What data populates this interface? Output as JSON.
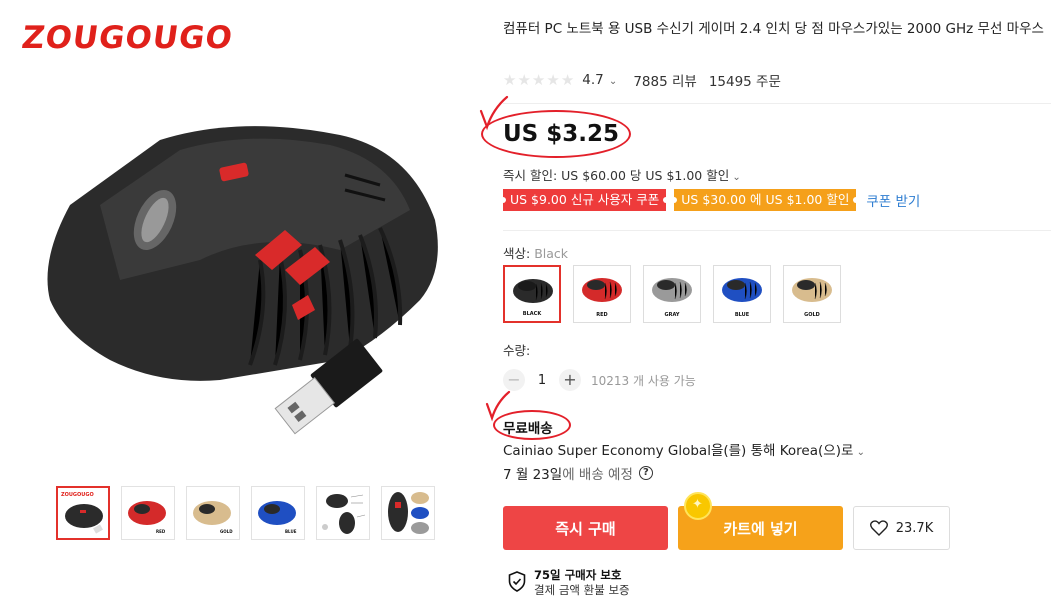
{
  "brand": {
    "logo_text": "ZOUGOUGO"
  },
  "product": {
    "title": "컴퓨터 PC 노트북 용 USB 수신기 게이머 2.4 인치 당 점 마우스가있는 2000 GHz 무선 마우스",
    "rating": "4.7",
    "reviews": "7885 리뷰",
    "orders": "15495 주문"
  },
  "price": {
    "current": "US $3.25",
    "instant_discount": "즉시 할인: US $60.00 당 US $1.00 할인",
    "coupons": [
      {
        "label": "US $9.00 신규 사용자 쿠폰",
        "color": "#ee3b3b"
      },
      {
        "label": "US $30.00 에 US $1.00 할인",
        "color": "#f5a01a"
      }
    ],
    "get_coupon": "쿠폰 받기"
  },
  "color": {
    "label": "색상:",
    "selected_name": "Black",
    "options": [
      {
        "name": "BLACK",
        "body": "#2a2a2a",
        "accent": "#1a1a1a"
      },
      {
        "name": "RED",
        "body": "#d42a2a",
        "accent": "#2a2a2a"
      },
      {
        "name": "GRAY",
        "body": "#9a9a9a",
        "accent": "#2a2a2a"
      },
      {
        "name": "BLUE",
        "body": "#1f4fc2",
        "accent": "#2a2a2a"
      },
      {
        "name": "GOLD",
        "body": "#d8bc8e",
        "accent": "#2a2a2a"
      }
    ]
  },
  "quantity": {
    "label": "수량:",
    "value": "1",
    "minus": "−",
    "plus": "+",
    "available": "10213 개 사용 가능"
  },
  "shipping": {
    "title": "무료배송",
    "method": "Cainiao Super Economy Global을(를) 통해 Korea(으)로",
    "delivery_date": "7 월 23일",
    "delivery_suffix": "에 배송 예정",
    "help": "?"
  },
  "actions": {
    "buy_now": "즉시 구매",
    "add_to_cart": "카트에 넣기",
    "wishlist_count": "23.7K"
  },
  "protection": {
    "title": "75일 구매자 보호",
    "subtitle": "결제 금액 환불 보증"
  },
  "thumbnails": [
    {
      "name": "black"
    },
    {
      "name": "red"
    },
    {
      "name": "gold"
    },
    {
      "name": "blue"
    },
    {
      "name": "diagram"
    },
    {
      "name": "multi"
    }
  ],
  "annotation_color": "#e3202a"
}
